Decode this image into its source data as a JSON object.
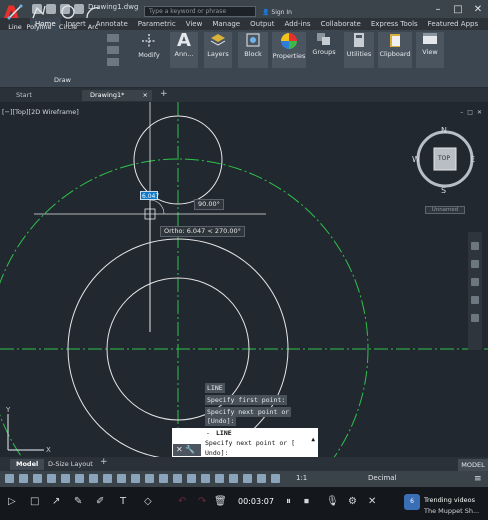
{
  "app": {
    "title": "Drawing1.dwg",
    "logo": "A",
    "search_placeholder": "Type a keyword or phrase",
    "signin_label": "Sign In",
    "window_buttons": [
      "–",
      "□",
      "✕"
    ]
  },
  "ribbon_tabs": [
    "Home",
    "Insert",
    "Annotate",
    "Parametric",
    "View",
    "Manage",
    "Output",
    "Add-ins",
    "Collaborate",
    "Express Tools",
    "Featured Apps"
  ],
  "ribbon_active_tab": "Home",
  "draw_tools": [
    "Line",
    "Polyline",
    "Circle",
    "Arc"
  ],
  "draw_panel_label": "Draw",
  "big_buttons": [
    "Modify",
    "Ann...",
    "Layers",
    "Block",
    "Properties",
    "Groups",
    "Utilities",
    "Clipboard",
    "View"
  ],
  "file_tabs": [
    "Start",
    "Drawing1*"
  ],
  "viewport": {
    "label": "[−][Top][2D Wireframe]",
    "controls": [
      "–",
      "□",
      "✕"
    ],
    "viewcube_face": "TOP",
    "compass": {
      "n": "N",
      "s": "S",
      "e": "E",
      "w": "W"
    },
    "unnamed_label": "Unnamed"
  },
  "dynamic_input": {
    "length_value": "6.047",
    "angle_value": "90.00°",
    "ortho_tooltip": "Ortho: 6.047 < 270.00°"
  },
  "command_history": [
    "LINE",
    "Specify first point:",
    "Specify next point or",
    "[Undo]:"
  ],
  "command_line": {
    "title": "LINE",
    "prompt_line1": "Specify next point or [",
    "prompt_line2": "Undo]:"
  },
  "layout_tabs": [
    "Model",
    "D-Size Layout"
  ],
  "status": {
    "model_label": "MODEL",
    "scale": "1:1",
    "units": "Decimal"
  },
  "recorder": {
    "time": "00:03:07"
  },
  "notification": {
    "title": "Trending videos",
    "subtitle": "The Muppet Sh..."
  },
  "colors": {
    "viewport_bg": "#212830",
    "ribbon_bg": "#3c4650",
    "center_line": "#2ec24a",
    "geometry": "#e6e6e6",
    "accent_blue": "#0d79c8",
    "logo_red": "#e8302c"
  }
}
